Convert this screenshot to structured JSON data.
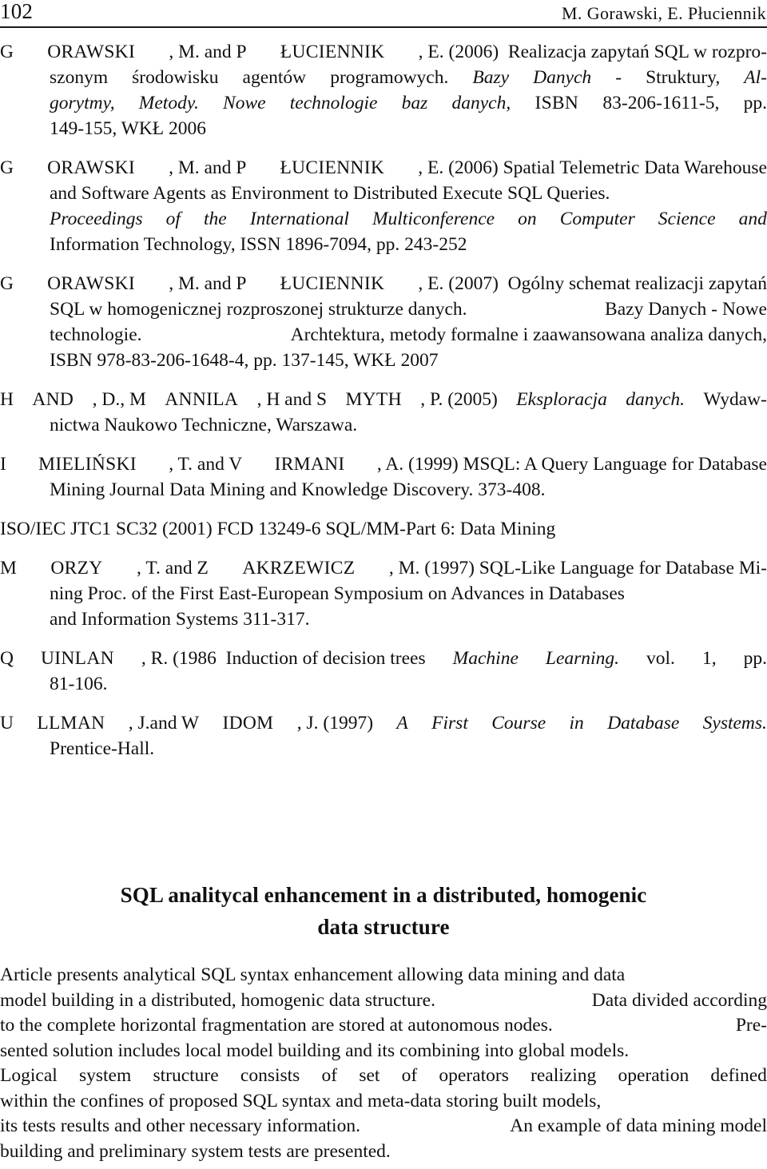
{
  "page": {
    "folio": "102",
    "running_head": "M. Gorawski, E. Płuciennik"
  },
  "references": [
    {
      "id": "gorawski-2006a",
      "lines": [
        {
          "indent": false,
          "justify": true,
          "words": [
            "G",
            "ORAWSKI",
            ", M. and P",
            "ŁUCIENNIK",
            ", E. (2006)  Realizacja zapytań SQL w rozpro-"
          ]
        },
        {
          "indent": true,
          "justify": true,
          "words": [
            "szonym",
            "środowisku",
            "agentów",
            "programowych.",
            "Bazy",
            "Danych",
            "-",
            "Struktury,",
            "Al-"
          ]
        },
        {
          "indent": true,
          "justify": true,
          "words": [
            "gorytmy,",
            "Metody.",
            "Nowe",
            "technologie",
            "baz",
            "danych,",
            "ISBN",
            "83-206-1611-5,",
            "pp."
          ]
        },
        {
          "indent": true,
          "justify": false,
          "words": [
            "149-155, WKŁ 2006"
          ]
        }
      ]
    },
    {
      "id": "gorawski-2006b",
      "lines": [
        {
          "indent": false,
          "justify": true,
          "words": [
            "G",
            "ORAWSKI",
            ", M. and P",
            "ŁUCIENNIK",
            ", E. (2006) Spatial Telemetric Data Warehouse"
          ]
        },
        {
          "indent": true,
          "justify": true,
          "words": [
            "and Software Agents as Environment to Distributed Execute SQL Queries."
          ]
        },
        {
          "indent": true,
          "justify": true,
          "words": [
            "Proceedings",
            "of",
            "the",
            "International",
            "Multiconference",
            "on",
            "Computer",
            "Science",
            "and"
          ]
        },
        {
          "indent": true,
          "justify": false,
          "words": [
            "Information Technology, ISSN 1896-7094, pp. 243-252"
          ]
        }
      ]
    },
    {
      "id": "gorawski-2007",
      "lines": [
        {
          "indent": false,
          "justify": true,
          "words": [
            "G",
            "ORAWSKI",
            ", M. and P",
            "ŁUCIENNIK",
            ", E. (2007)  Ogólny schemat realizacji zapytań"
          ]
        },
        {
          "indent": true,
          "justify": true,
          "words": [
            "SQL w homogenicznej rozproszonej strukturze danych.",
            "Bazy Danych - Nowe"
          ]
        },
        {
          "indent": true,
          "justify": true,
          "words": [
            "technologie.",
            "Archtektura, metody formalne i zaawansowana analiza danych,"
          ]
        },
        {
          "indent": true,
          "justify": false,
          "words": [
            "ISBN 978-83-206-1648-4, pp. 137-145, WKŁ 2007"
          ]
        }
      ]
    },
    {
      "id": "hand-2005",
      "lines": [
        {
          "indent": false,
          "justify": true,
          "words": [
            "H",
            "AND",
            ", D., M",
            "ANNILA",
            ", H and S",
            "MYTH",
            ", P. (2005)",
            "Eksploracja",
            "danych.",
            "Wydaw-"
          ]
        },
        {
          "indent": true,
          "justify": false,
          "words": [
            "nictwa Naukowo Techniczne, Warszawa."
          ]
        }
      ]
    },
    {
      "id": "imielinski-1999",
      "lines": [
        {
          "indent": false,
          "justify": true,
          "words": [
            "I",
            "MIELIŃSKI",
            ", T. and V",
            "IRMANI",
            ", A. (1999) MSQL: A Query Language for Database"
          ]
        },
        {
          "indent": true,
          "justify": false,
          "words": [
            "Mining Journal Data Mining and Knowledge Discovery. 373-408."
          ]
        }
      ]
    },
    {
      "id": "iso-iec-2001",
      "lines": [
        {
          "indent": false,
          "justify": false,
          "words": [
            "ISO/IEC JTC1 SC32 (2001) FCD 13249-6 SQL/MM-Part 6: Data Mining"
          ]
        }
      ]
    },
    {
      "id": "morzy-1997",
      "lines": [
        {
          "indent": false,
          "justify": true,
          "words": [
            "M",
            "ORZY",
            ", T. and Z",
            "AKRZEWICZ",
            ", M. (1997) SQL-Like Language for Database Mi-"
          ]
        },
        {
          "indent": true,
          "justify": true,
          "words": [
            "ning Proc. of the First East-European Symposium on Advances in Databases"
          ]
        },
        {
          "indent": true,
          "justify": false,
          "words": [
            "and Information Systems 311-317."
          ]
        }
      ]
    },
    {
      "id": "quinlan-1986",
      "lines": [
        {
          "indent": false,
          "justify": true,
          "words": [
            "Q",
            "UINLAN",
            ", R. (1986  Induction of decision trees",
            "Machine",
            "Learning.",
            "vol.",
            "1,",
            "pp."
          ]
        },
        {
          "indent": true,
          "justify": false,
          "words": [
            "81-106."
          ]
        }
      ]
    },
    {
      "id": "ullman-1997",
      "lines": [
        {
          "indent": false,
          "justify": true,
          "words": [
            "U",
            "LLMAN",
            ", J.and W",
            "IDOM",
            ", J. (1997)",
            "A",
            "First",
            "Course",
            "in",
            "Database",
            "Systems."
          ]
        },
        {
          "indent": true,
          "justify": false,
          "words": [
            "Prentice-Hall."
          ]
        }
      ]
    }
  ],
  "article": {
    "title_lines": [
      "SQL analitycal enhancement in a distributed, homogenic",
      "data structure"
    ],
    "abstract_lines": [
      {
        "justify": true,
        "words": [
          "Article presents analytical SQL syntax enhancement allowing data mining and data"
        ]
      },
      {
        "justify": true,
        "words": [
          "model building in a distributed, homogenic data structure.",
          "Data divided according"
        ]
      },
      {
        "justify": true,
        "words": [
          "to the complete horizontal fragmentation are stored at autonomous nodes.",
          "Pre-"
        ]
      },
      {
        "justify": true,
        "words": [
          "sented solution includes local model building and its combining into global models."
        ]
      },
      {
        "justify": true,
        "words": [
          "Logical",
          "system",
          "structure",
          "consists",
          "of",
          "set",
          "of",
          "operators",
          "realizing",
          "operation",
          "defined"
        ]
      },
      {
        "justify": true,
        "words": [
          "within the confines of proposed SQL syntax and meta-data storing built models,"
        ]
      },
      {
        "justify": true,
        "words": [
          "its tests results and other necessary information.",
          "An example of data mining model"
        ]
      },
      {
        "justify": false,
        "words": [
          "building and preliminary system tests are presented."
        ]
      }
    ]
  }
}
